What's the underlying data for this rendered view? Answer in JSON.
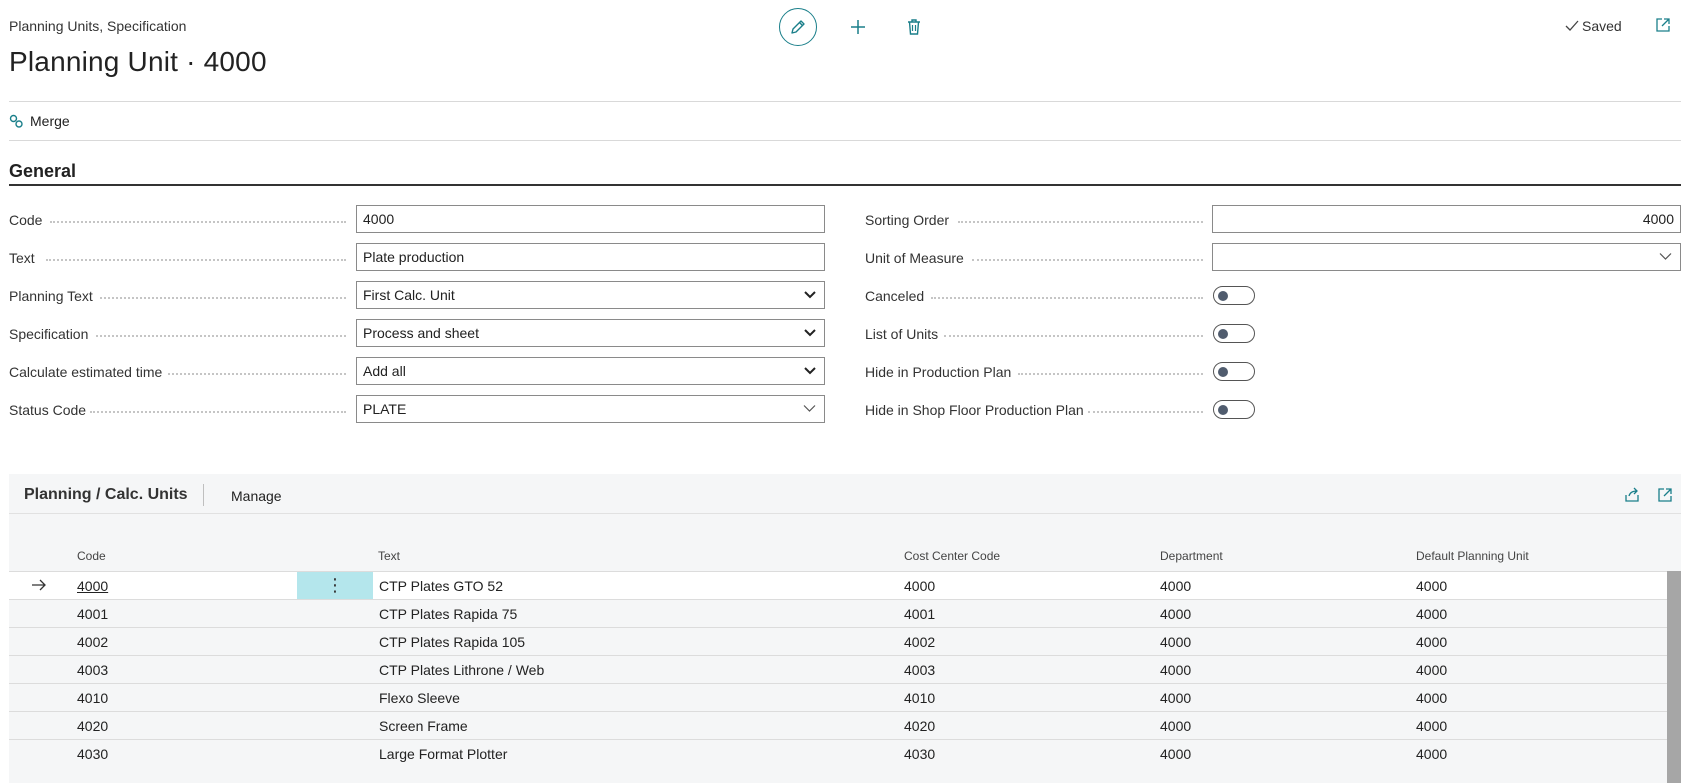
{
  "breadcrumb": "Planning Units, Specification",
  "page_title": "Planning Unit · 4000",
  "status": {
    "saved": "Saved"
  },
  "actions": {
    "merge": "Merge"
  },
  "section": {
    "general": "General"
  },
  "fields_left": [
    {
      "label": "Code",
      "value": "4000",
      "type": "text"
    },
    {
      "label": "Text",
      "value": "Plate production",
      "type": "text"
    },
    {
      "label": "Planning Text",
      "value": "First Calc. Unit",
      "type": "select"
    },
    {
      "label": "Specification",
      "value": "Process and sheet",
      "type": "select"
    },
    {
      "label": "Calculate estimated time",
      "value": "Add all",
      "type": "select"
    },
    {
      "label": "Status Code",
      "value": "PLATE",
      "type": "lookup"
    }
  ],
  "fields_right": [
    {
      "label": "Sorting Order",
      "value": "4000",
      "type": "number"
    },
    {
      "label": "Unit of Measure",
      "value": "",
      "type": "lookup"
    },
    {
      "label": "Canceled",
      "value": "off",
      "type": "toggle"
    },
    {
      "label": "List of Units",
      "value": "off",
      "type": "toggle"
    },
    {
      "label": "Hide in Production Plan",
      "value": "off",
      "type": "toggle"
    },
    {
      "label": "Hide in Shop Floor Production Plan",
      "value": "off",
      "type": "toggle"
    }
  ],
  "grid": {
    "title": "Planning / Calc. Units",
    "manage": "Manage",
    "columns": [
      "Code",
      "Text",
      "Cost Center Code",
      "Department",
      "Default Planning Unit"
    ],
    "rows": [
      [
        "4000",
        "CTP Plates GTO 52",
        "4000",
        "4000",
        "4000"
      ],
      [
        "4001",
        "CTP Plates Rapida 75",
        "4001",
        "4000",
        "4000"
      ],
      [
        "4002",
        "CTP Plates Rapida 105",
        "4002",
        "4000",
        "4000"
      ],
      [
        "4003",
        "CTP Plates Lithrone / Web",
        "4003",
        "4000",
        "4000"
      ],
      [
        "4010",
        "Flexo Sleeve",
        "4010",
        "4000",
        "4000"
      ],
      [
        "4020",
        "Screen Frame",
        "4020",
        "4000",
        "4000"
      ],
      [
        "4030",
        "Large Format Plotter",
        "4030",
        "4000",
        "4000"
      ]
    ]
  },
  "colors": {
    "accent": "#1a7f8a",
    "selected_row_menu": "#b4e6ec"
  }
}
